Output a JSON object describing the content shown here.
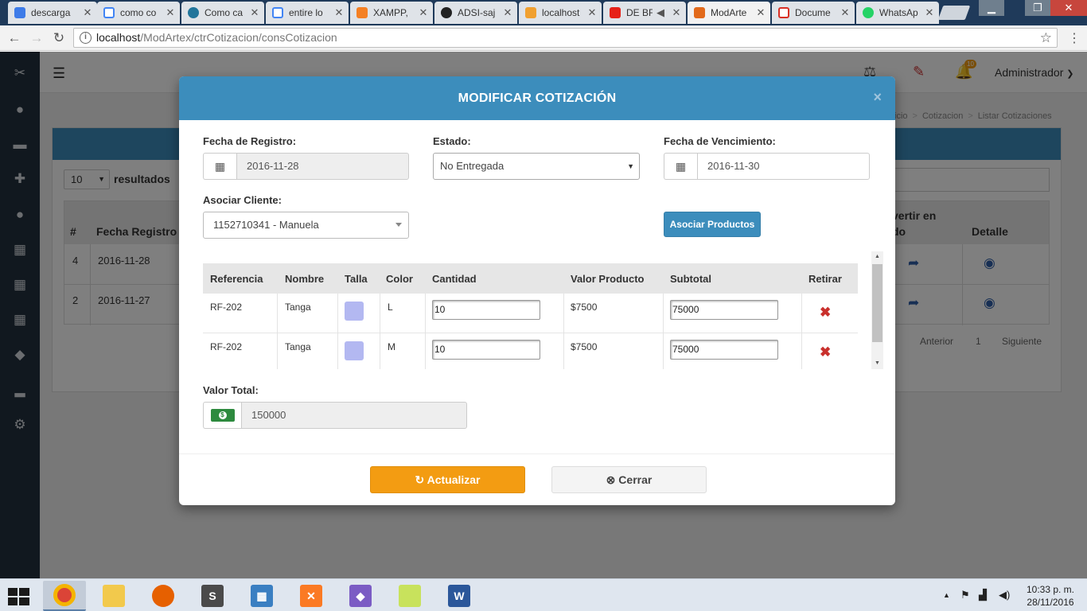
{
  "browser": {
    "tabs": [
      {
        "label": "descarga",
        "icon": "dropbox-icon",
        "color": "#3d7be8"
      },
      {
        "label": "como co",
        "icon": "google-icon",
        "color": "#ffffff"
      },
      {
        "label": "Como ca",
        "icon": "wordpress-icon",
        "color": "#21759b"
      },
      {
        "label": "entire lo",
        "icon": "google-icon",
        "color": "#ffffff"
      },
      {
        "label": "XAMPP,",
        "icon": "stackoverflow-icon",
        "color": "#f48024"
      },
      {
        "label": "ADSI-saj",
        "icon": "github-icon",
        "color": "#222222"
      },
      {
        "label": "localhost",
        "icon": "phpmyadmin-icon",
        "color": "#f0a030"
      },
      {
        "label": "DE BF",
        "icon": "youtube-icon",
        "color": "#e62117"
      },
      {
        "label": "ModArte",
        "icon": "modartex-icon",
        "color": "#e26a1b"
      },
      {
        "label": "Docume",
        "icon": "gmail-icon",
        "color": "#d93025"
      },
      {
        "label": "WhatsAp",
        "icon": "whatsapp-icon",
        "color": "#25d366"
      }
    ],
    "active_tab_index": 8,
    "url_host": "localhost",
    "url_path": "/ModArtex/ctrCotizacion/consCotizacion"
  },
  "app": {
    "user": "Administrador",
    "notifications_count": "10",
    "breadcrumb": [
      "Inicio",
      "Cotizacion",
      "Listar Cotizaciones"
    ],
    "breadcrumb_visible_first": "icio",
    "results_select": "10",
    "results_label": "resultados",
    "table": {
      "headers": [
        "#",
        "Fecha Registro",
        "vertir en",
        "do",
        "Detalle"
      ],
      "rows": [
        {
          "num": "4",
          "fecha": "2016-11-28"
        },
        {
          "num": "2",
          "fecha": "2016-11-27"
        }
      ]
    },
    "pagination": {
      "prev": "Anterior",
      "page": "1",
      "next": "Siguiente"
    }
  },
  "modal": {
    "title": "MODIFICAR COTIZACIÓN",
    "close_glyph": "×",
    "fecha_registro_label": "Fecha de Registro:",
    "fecha_registro_value": "2016-11-28",
    "estado_label": "Estado:",
    "estado_value": "No Entregada",
    "fecha_venc_label": "Fecha de Vencimiento:",
    "fecha_venc_value": "2016-11-30",
    "cliente_label": "Asociar Cliente:",
    "cliente_value": "1152710341 - Manuela",
    "asociar_productos_label": "Asociar Productos",
    "products": {
      "headers": [
        "Referencia",
        "Nombre",
        "Talla",
        "Color",
        "Cantidad",
        "Valor Producto",
        "Subtotal",
        "Retirar"
      ],
      "rows": [
        {
          "ref": "RF-202",
          "nombre": "Tanga",
          "swatch": "#b3b8f1",
          "talla_text": "L",
          "cantidad": "10",
          "valor": "$7500",
          "subtotal": "75000"
        },
        {
          "ref": "RF-202",
          "nombre": "Tanga",
          "swatch": "#b3b8f1",
          "talla_text": "M",
          "cantidad": "10",
          "valor": "$7500",
          "subtotal": "75000"
        }
      ]
    },
    "valor_total_label": "Valor Total:",
    "valor_total_value": "150000",
    "actualizar_label": "Actualizar",
    "cerrar_label": "Cerrar"
  },
  "taskbar": {
    "time": "10:33 p. m.",
    "date": "28/11/2016"
  },
  "colors": {
    "primary": "#3c8dbc",
    "warning": "#f39c12",
    "danger": "#c9302c",
    "sidebar": "#23313e"
  }
}
